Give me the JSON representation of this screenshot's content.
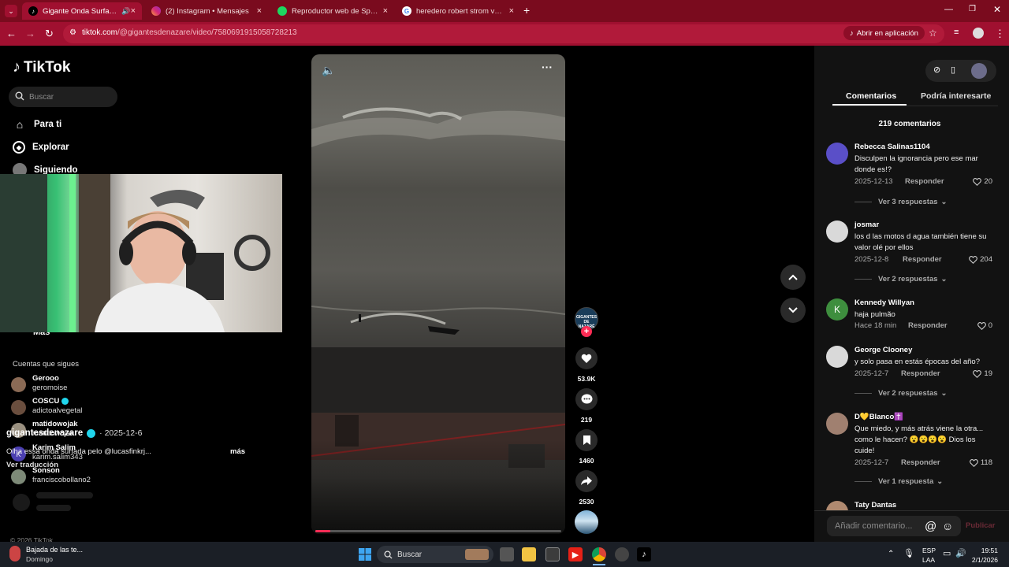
{
  "browser": {
    "tabs": [
      {
        "title": "Gigante Onda Surfada por",
        "active": true
      },
      {
        "title": "(2) Instagram • Mensajes",
        "active": false
      },
      {
        "title": "Reproductor web de Spotify: m",
        "active": false
      },
      {
        "title": "heredero robert strom vs baule",
        "active": false
      }
    ],
    "url_host": "tiktok.com",
    "url_path": "/@gigantesdenazare/video/7580691915058728213",
    "open_in_app": "Abrir en aplicación"
  },
  "sidebar": {
    "logo": "TikTok",
    "search_placeholder": "Buscar",
    "nav": [
      {
        "label": "Para ti",
        "icon": "home-icon"
      },
      {
        "label": "Explorar",
        "icon": "compass-icon"
      },
      {
        "label": "Siguiendo",
        "icon": "following-avatar"
      }
    ],
    "more_label": "Más",
    "following_heading": "Cuentas que sigues",
    "following": [
      {
        "name": "Gerooo",
        "user": "geromoise",
        "verified": false,
        "avatar_color": "#8a6a55"
      },
      {
        "name": "COSCU",
        "user": "adictoalvegetal",
        "verified": true,
        "avatar_color": "#6a4e3e"
      },
      {
        "name": "matidowojak",
        "user": "matidowojak",
        "verified": false,
        "avatar_color": "#9a9080"
      },
      {
        "name": "Karim Salim",
        "user": "karim.salim343",
        "verified": false,
        "avatar_letter": "K",
        "avatar_color": "#4b3fb0"
      },
      {
        "name": "Sonson",
        "user": "franciscobollano2",
        "verified": false,
        "avatar_color": "#7d8a78"
      }
    ],
    "copyright": "© 2026 TikTok"
  },
  "video": {
    "author": "gigantesdenazare",
    "date": "· 2025-12-6",
    "caption": "Olha essa onda surfada pelo @lucasfinkrj...",
    "more": "más",
    "translate": "Ver traducción",
    "progress": 0.06,
    "creator_badge": "GIGANTES DE NAZARÉ",
    "likes": "53.9K",
    "comments": "219",
    "saves": "1460",
    "shares": "2530"
  },
  "comments_panel": {
    "tab_comments": "Comentarios",
    "tab_interesting": "Podría interesarte",
    "count_label": "219 comentarios",
    "reply_label": "Responder",
    "items": [
      {
        "user": "Rebecca Salinas1104",
        "text": "Disculpen la ignorancia pero ese mar donde es!?",
        "date": "2025-12-13",
        "likes": "20",
        "thread": "Ver 3 respuestas",
        "avatar_color": "#5a4fc8"
      },
      {
        "user": "josmar",
        "text": "los d las motos d agua también tiene su valor olé por ellos",
        "date": "2025-12-8",
        "likes": "204",
        "thread": "Ver 2 respuestas",
        "avatar_color": "#d9d9d9"
      },
      {
        "user": "Kennedy Willyan",
        "text": "haja pulmão",
        "date": "Hace 18 min",
        "likes": "0",
        "thread": "",
        "avatar_letter": "K",
        "avatar_color": "#3e8e3e"
      },
      {
        "user": "George Clooney",
        "text": "y solo pasa en estás épocas del año?",
        "date": "2025-12-7",
        "likes": "19",
        "thread": "Ver 2 respuestas",
        "avatar_color": "#d9d9d9"
      },
      {
        "user": "D💛Blanco✝️",
        "text": "Que miedo, y más atrás viene la otra... como le hacen? 😮😮😮😮 Dios los cuide!",
        "date": "2025-12-7",
        "likes": "118",
        "thread": "Ver 1 respuesta",
        "avatar_color": "#a08070"
      },
      {
        "user": "Taty Dantas",
        "text": "",
        "date": "",
        "likes": "",
        "thread": "",
        "avatar_color": "#b08a70"
      }
    ],
    "add_placeholder": "Añadir comentario...",
    "publish": "Publicar"
  },
  "taskbar": {
    "notification_title": "Bajada de las te...",
    "notification_sub": "Domingo",
    "search": "Buscar",
    "lang": "ESP",
    "lang_sub": "LAA",
    "time": "19:51",
    "date": "2/1/2026"
  },
  "colors": {
    "tab_bar": "#7a0b1e",
    "address_bar": "#a01030",
    "tiktok_red": "#fe2c55",
    "verified": "#20d5ec"
  }
}
